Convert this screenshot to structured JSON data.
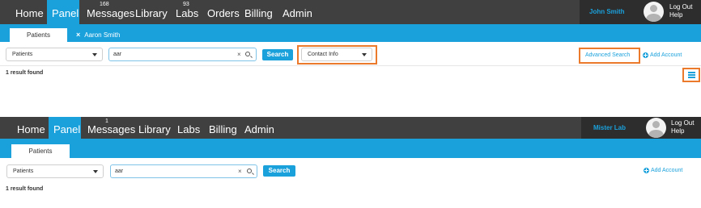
{
  "screen1": {
    "nav": [
      {
        "label": "Home",
        "badge": ""
      },
      {
        "label": "Panel",
        "badge": ""
      },
      {
        "label": "Messages",
        "badge": "168"
      },
      {
        "label": "Library",
        "badge": ""
      },
      {
        "label": "Labs",
        "badge": "93"
      },
      {
        "label": "Orders",
        "badge": ""
      },
      {
        "label": "Billing",
        "badge": ""
      },
      {
        "label": "Admin",
        "badge": ""
      }
    ],
    "active_nav": "Panel",
    "user_name": "John Smith",
    "logout_label": "Log Out",
    "help_label": "Help",
    "tabs": [
      {
        "label": "Patients",
        "active": true
      },
      {
        "label": "Aaron Smith",
        "active": false,
        "close_glyph": "×"
      }
    ],
    "category_select": "Patients",
    "search_value": "aar",
    "clear_glyph": "×",
    "search_button": "Search",
    "field_select": "Contact Info",
    "advanced_search": "Advanced Search",
    "add_account": "Add Account",
    "result_text": "1 result found"
  },
  "screen2": {
    "nav": [
      {
        "label": "Home",
        "badge": ""
      },
      {
        "label": "Panel",
        "badge": ""
      },
      {
        "label": "Messages",
        "badge": "1"
      },
      {
        "label": "Library",
        "badge": ""
      },
      {
        "label": "Labs",
        "badge": ""
      },
      {
        "label": "Billing",
        "badge": ""
      },
      {
        "label": "Admin",
        "badge": ""
      }
    ],
    "active_nav": "Panel",
    "user_name": "Mister Lab",
    "logout_label": "Log Out",
    "help_label": "Help",
    "tabs": [
      {
        "label": "Patients",
        "active": true
      }
    ],
    "category_select": "Patients",
    "search_value": "aar",
    "clear_glyph": "×",
    "search_button": "Search",
    "add_account": "Add Account",
    "result_text": "1 result found"
  },
  "colors": {
    "nav_bar": "#404040",
    "user_bar": "#2d2d2d",
    "accent": "#1aa1dc",
    "highlight": "#ec7a2c"
  }
}
